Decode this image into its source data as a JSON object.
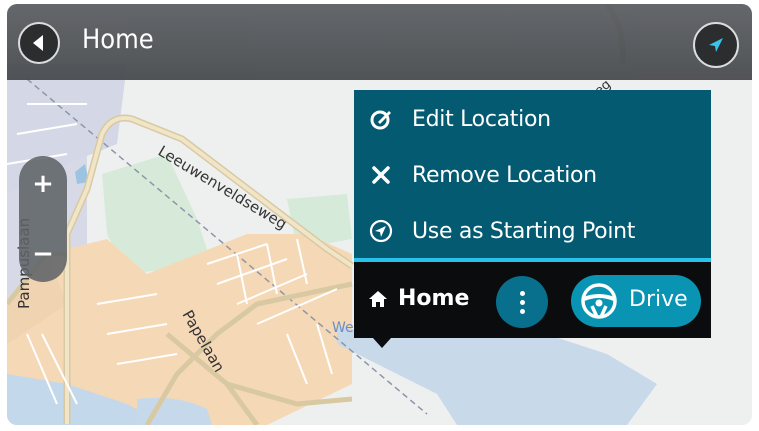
{
  "header": {
    "title": "Home"
  },
  "map": {
    "street_labels": [
      "Leeuwenveldseweg",
      "Pampuslaan",
      "Papelaan",
      "We",
      "eg"
    ],
    "zoom_in_label": "+",
    "zoom_out_label": "−"
  },
  "popup_menu": {
    "items": [
      {
        "label": "Edit Location",
        "icon": "edit-icon"
      },
      {
        "label": "Remove Location",
        "icon": "close-icon"
      },
      {
        "label": "Use as Starting Point",
        "icon": "navigate-icon"
      }
    ]
  },
  "bottom_bar": {
    "location_label": "Home",
    "location_icon": "home-icon",
    "more_icon": "more-vertical-icon",
    "drive_label": "Drive",
    "drive_icon": "steering-wheel-icon"
  },
  "colors": {
    "menu_bg": "#045a70",
    "accent": "#28c2ea",
    "drive_button": "#0a94b4",
    "more_button": "#08708c",
    "bottom_bar_bg": "#0b0c0d"
  }
}
